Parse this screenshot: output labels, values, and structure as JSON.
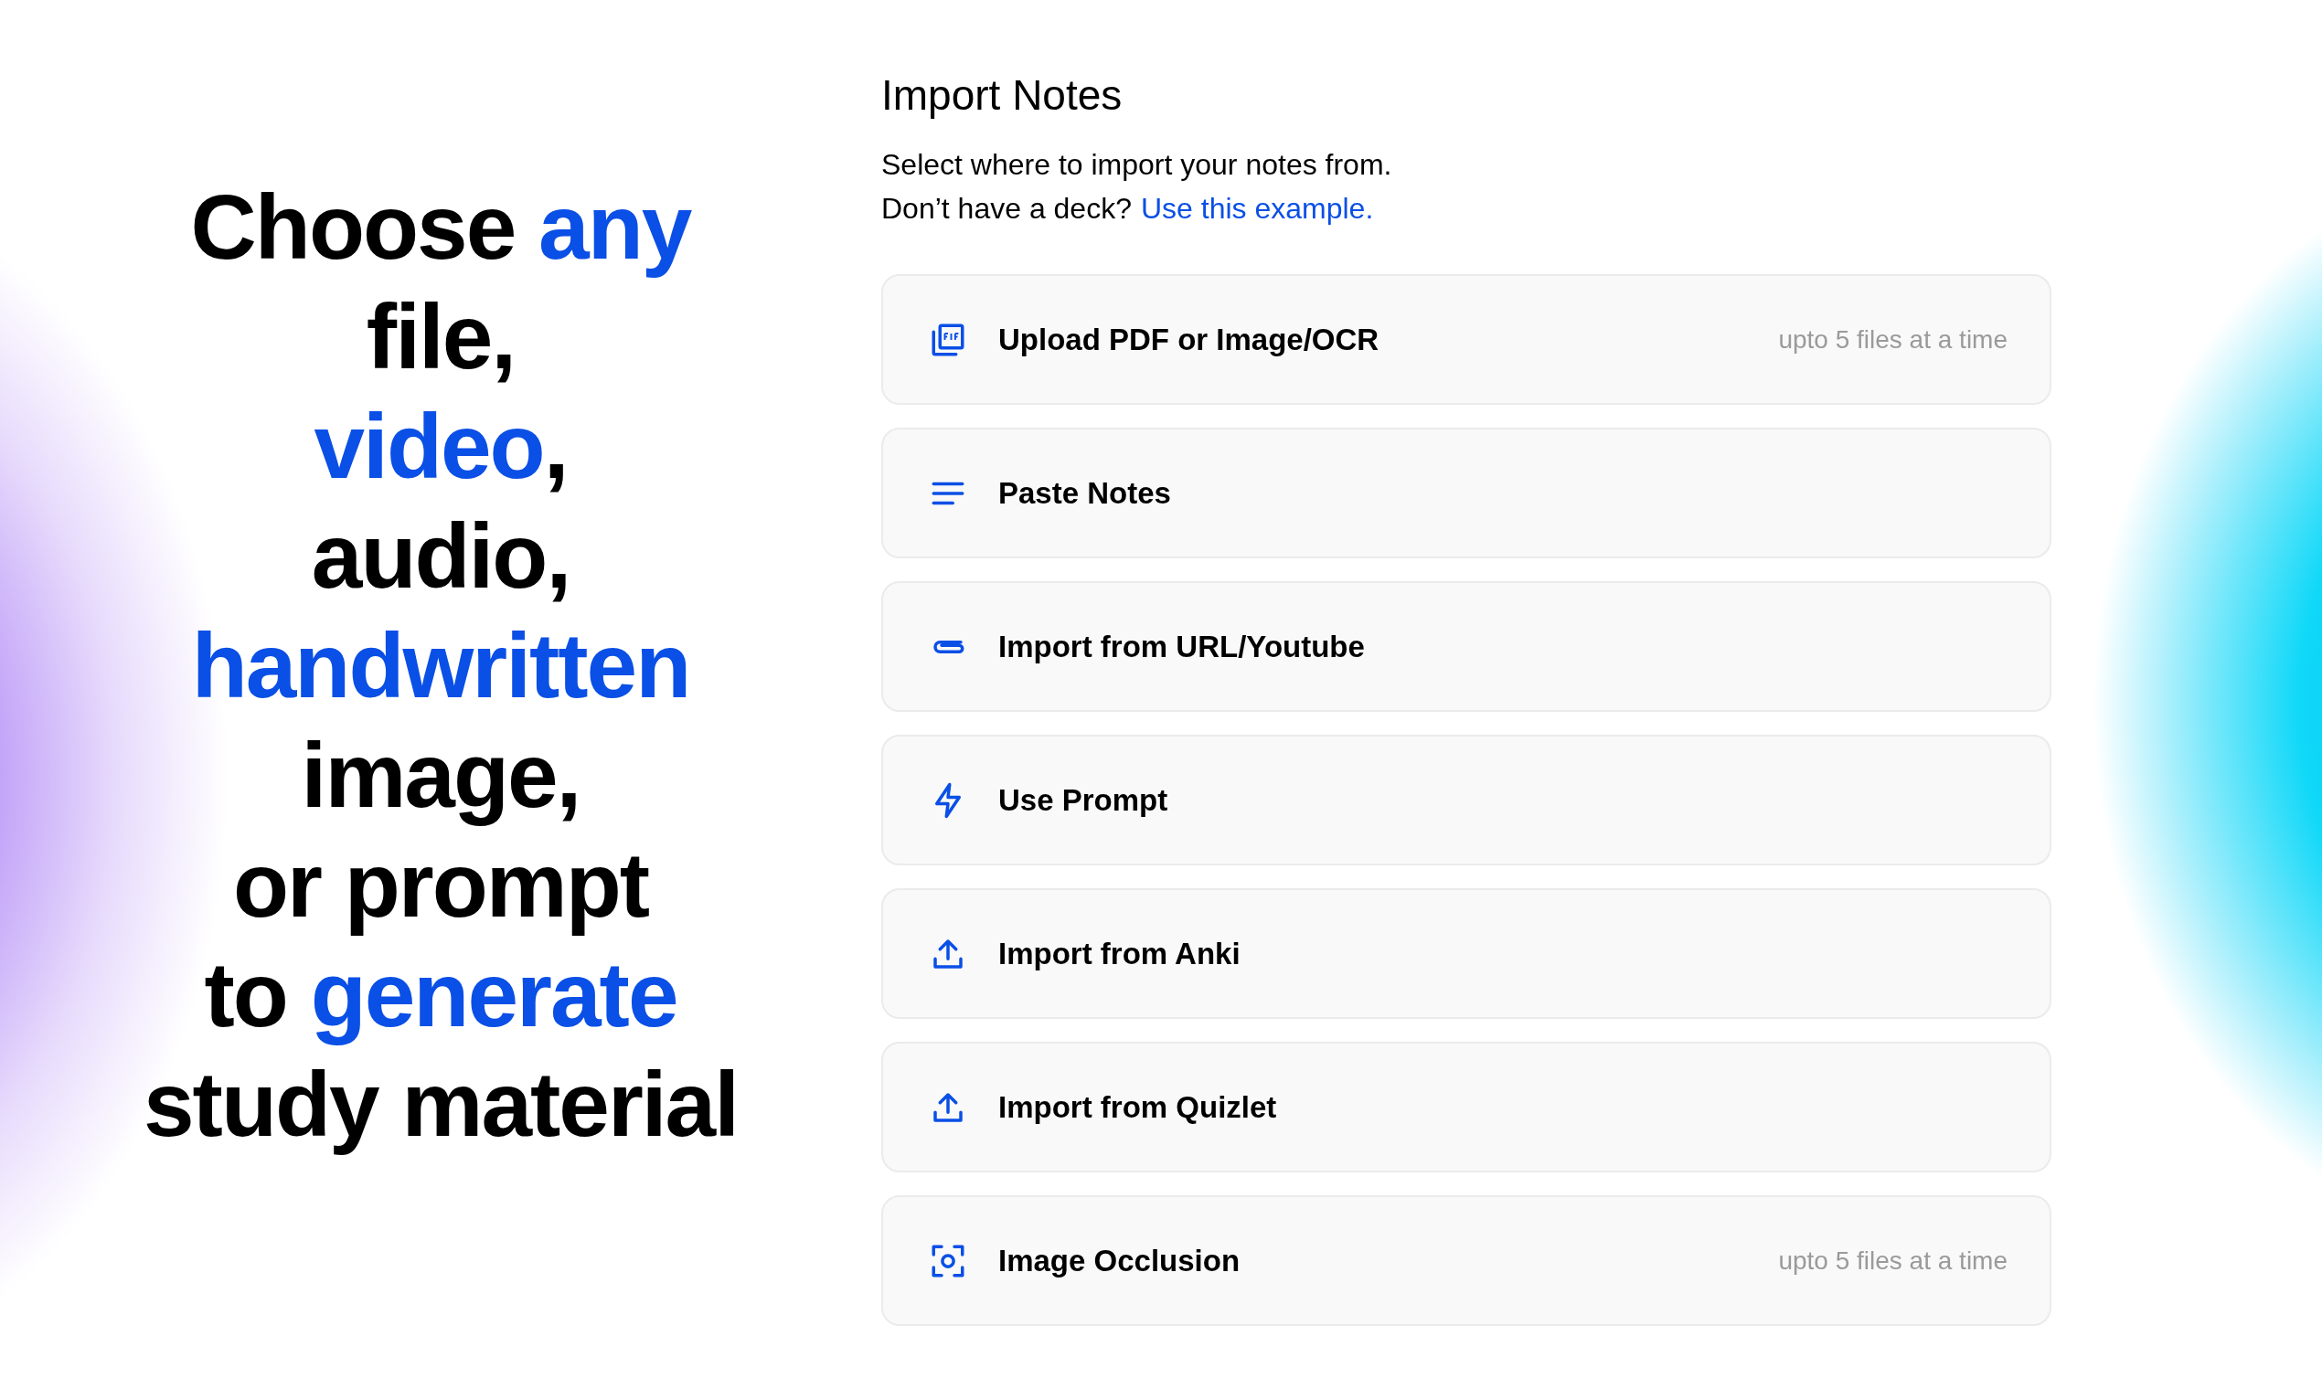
{
  "headline": [
    [
      {
        "text": "Choose ",
        "accent": false
      },
      {
        "text": "any",
        "accent": true
      }
    ],
    [
      {
        "text": "file,",
        "accent": false
      }
    ],
    [
      {
        "text": "video",
        "accent": true
      },
      {
        "text": ",",
        "accent": false
      }
    ],
    [
      {
        "text": "audio,",
        "accent": false
      }
    ],
    [
      {
        "text": "handwritten",
        "accent": true
      }
    ],
    [
      {
        "text": "image,",
        "accent": false
      }
    ],
    [
      {
        "text": "or prompt",
        "accent": false
      }
    ],
    [
      {
        "text": "to ",
        "accent": false
      },
      {
        "text": "generate",
        "accent": true
      }
    ],
    [
      {
        "text": "study material",
        "accent": false
      }
    ]
  ],
  "panel": {
    "title": "Import Notes",
    "subtitle": "Select where to import your notes from.",
    "prompt": "Don’t have a deck?",
    "link": "Use this example.",
    "options": [
      {
        "kind": "pdf",
        "label": "Upload PDF or Image/OCR",
        "note": "upto 5 files at a time"
      },
      {
        "kind": "paste",
        "label": "Paste Notes"
      },
      {
        "kind": "link",
        "label": "Import from URL/Youtube"
      },
      {
        "kind": "prompt",
        "label": "Use Prompt"
      },
      {
        "kind": "upload",
        "label": "Import from Anki"
      },
      {
        "kind": "upload",
        "label": "Import from Quizlet"
      },
      {
        "kind": "scan",
        "label": "Image Occlusion",
        "note": "upto 5 files at a time"
      }
    ]
  }
}
